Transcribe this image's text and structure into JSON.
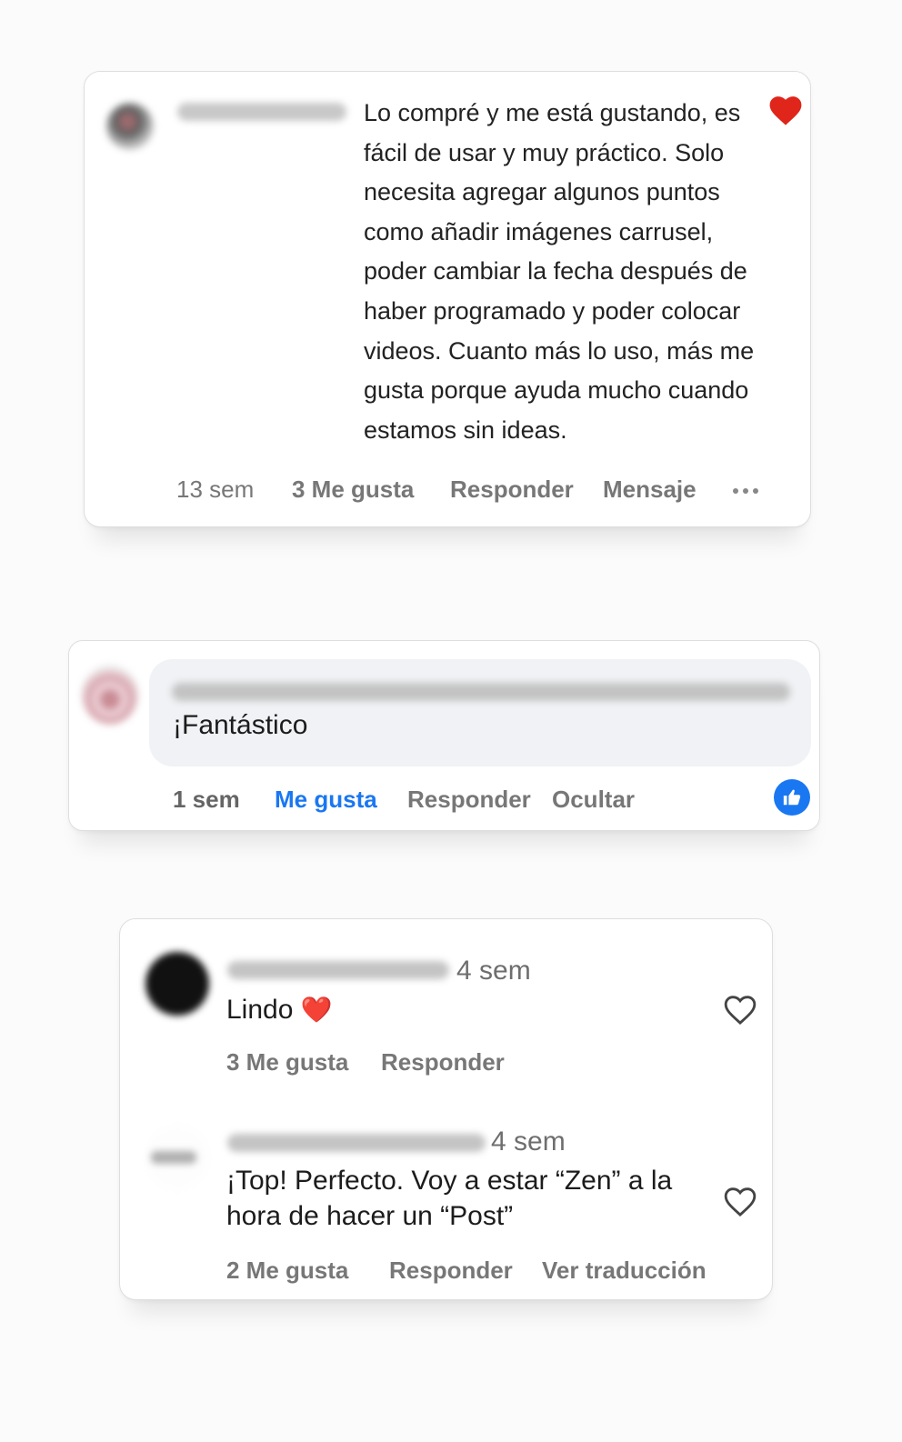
{
  "comment1": {
    "text": "Lo compré y me está gustando, es fácil de usar y muy práctico. Solo necesita agregar algunos puntos como añadir imágenes carrusel, poder cambiar la fecha después de haber programado y poder colocar videos. Cuanto más lo uso, más me gusta porque ayuda mucho cuando estamos sin ideas.",
    "time": "13 sem",
    "likes": "3 Me gusta",
    "reply": "Responder",
    "message": "Mensaje",
    "more_icon": "more-horizontal-icon",
    "reaction_icon": "heart-filled-icon"
  },
  "comment2": {
    "text": "¡Fantástico",
    "time": "1 sem",
    "like": "Me gusta",
    "reply": "Responder",
    "hide": "Ocultar",
    "reaction_icon": "thumbs-up-icon"
  },
  "comment3": {
    "time": "4 sem",
    "text": "Lindo",
    "emoji": "❤️",
    "likes": "3 Me gusta",
    "reply": "Responder",
    "like_icon": "heart-outline-icon"
  },
  "comment4": {
    "time": "4 sem",
    "text": "¡Top! Perfecto. Voy a estar “Zen” a la hora de hacer un “Post”",
    "likes": "2 Me gusta",
    "reply": "Responder",
    "translate": "Ver traducción",
    "like_icon": "heart-outline-icon"
  },
  "colors": {
    "accent_blue": "#1a77f2",
    "heart_red": "#e0251b",
    "meta_gray": "#777777"
  }
}
